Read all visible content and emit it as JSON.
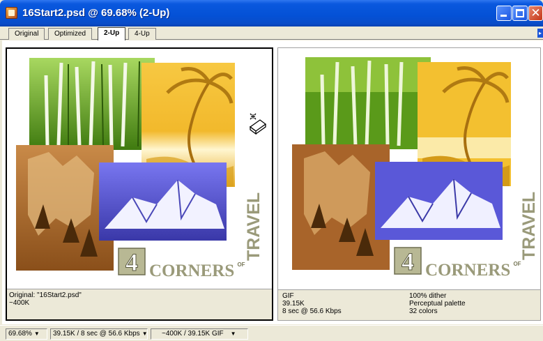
{
  "window": {
    "title": "16Start2.psd @ 69.68% (2-Up)",
    "close_glyph": "✕"
  },
  "tabs": [
    {
      "label": "Original",
      "active": false
    },
    {
      "label": "Optimized",
      "active": false
    },
    {
      "label": "2-Up",
      "active": true
    },
    {
      "label": "4-Up",
      "active": false
    }
  ],
  "artwork": {
    "number": "4",
    "of": "OF",
    "corners": "CORNERS",
    "travel": "TRAVEL"
  },
  "left_pane": {
    "line1": "Original: \"16Start2.psd\"",
    "line2": "~400K"
  },
  "right_pane": {
    "col1": [
      "GIF",
      "39.15K",
      "8 sec @ 56.6 Kbps"
    ],
    "col2": [
      "100% dither",
      "Perceptual palette",
      "32 colors"
    ]
  },
  "status": {
    "zoom": "69.68%",
    "download": "39.15K / 8 sec @ 56.6 Kbps",
    "size": "~400K / 39.15K GIF"
  },
  "colors": {
    "titlebar": "#0451d6",
    "forest_green": "#5a9a1a",
    "palm_yellow": "#f3c030",
    "canyon_brown": "#b06a2a",
    "mountain_blue": "#5a58d8",
    "text_gray": "#7a7a5a"
  },
  "icons": {
    "app": "photoshop-document-icon",
    "cursor": "eyedropper-sparkle-cursor"
  }
}
